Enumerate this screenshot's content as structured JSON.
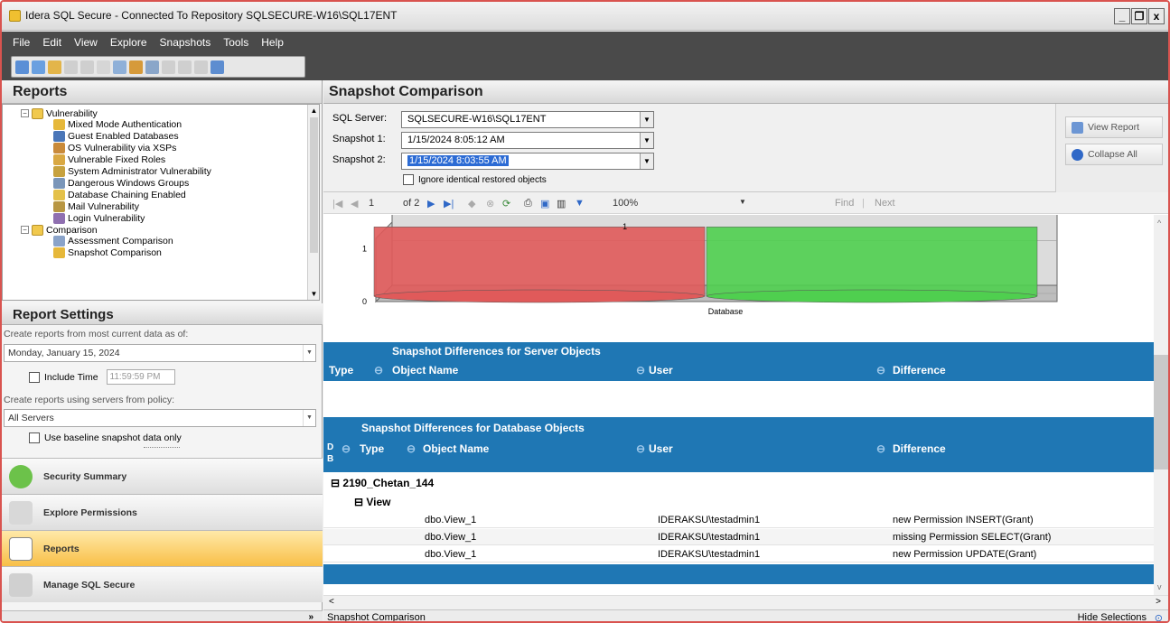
{
  "window": {
    "title": "Idera SQL Secure - Connected To Repository SQLSECURE-W16\\SQL17ENT",
    "controls": [
      "_",
      "❐",
      "x"
    ]
  },
  "menu": [
    "File",
    "Edit",
    "View",
    "Explore",
    "Snapshots",
    "Tools",
    "Help"
  ],
  "reports_pane": {
    "title": "Reports",
    "tree": [
      {
        "label": "Vulnerability",
        "level": 1,
        "type": "folder",
        "expand": "−"
      },
      {
        "label": "Mixed Mode Authentication",
        "level": 2
      },
      {
        "label": "Guest Enabled Databases",
        "level": 2
      },
      {
        "label": "OS Vulnerability via XSPs",
        "level": 2
      },
      {
        "label": "Vulnerable Fixed Roles",
        "level": 2
      },
      {
        "label": "System Administrator Vulnerability",
        "level": 2
      },
      {
        "label": "Dangerous Windows Groups",
        "level": 2
      },
      {
        "label": "Database Chaining Enabled",
        "level": 2
      },
      {
        "label": "Mail Vulnerability",
        "level": 2
      },
      {
        "label": "Login Vulnerability",
        "level": 2
      },
      {
        "label": "Comparison",
        "level": 1,
        "type": "folder",
        "expand": "−"
      },
      {
        "label": "Assessment Comparison",
        "level": 2
      },
      {
        "label": "Snapshot Comparison",
        "level": 2
      }
    ]
  },
  "report_settings": {
    "title": "Report Settings",
    "date_label": "Create reports from most current data as of:",
    "date_value": "Monday, January 15, 2024",
    "include_time_label": "Include Time",
    "time_value": "11:59:59 PM",
    "policy_label": "Create reports using servers from policy:",
    "policy_value": "All Servers",
    "baseline_label": "Use baseline snapshot data only"
  },
  "nav": [
    {
      "label": "Security Summary",
      "active": false
    },
    {
      "label": "Explore Permissions",
      "active": false
    },
    {
      "label": "Reports",
      "active": true
    },
    {
      "label": "Manage SQL Secure",
      "active": false
    }
  ],
  "snapshot_comparison": {
    "title": "Snapshot Comparison",
    "sql_server_label": "SQL Server:",
    "sql_server_value": "SQLSECURE-W16\\SQL17ENT",
    "snapshot1_label": "Snapshot 1:",
    "snapshot1_value": "1/15/2024 8:05:12 AM",
    "snapshot2_label": "Snapshot 2:",
    "snapshot2_value": "1/15/2024 8:03:55 AM",
    "ignore_label": "Ignore identical restored objects",
    "view_report_label": "View Report",
    "collapse_all_label": "Collapse All"
  },
  "report_toolbar": {
    "page": "1",
    "of": "of 2",
    "zoom": "100%",
    "find": "Find",
    "next": "Next"
  },
  "chart_data": {
    "type": "bar",
    "categories": [
      "Database"
    ],
    "series": [
      {
        "values": [
          1
        ],
        "color": "#e05a5a"
      },
      {
        "values": [
          1
        ],
        "color": "#4fcf4f"
      }
    ],
    "yticks": [
      "0",
      "1"
    ],
    "data_labels": [
      "1"
    ],
    "xlabel": "Database"
  },
  "server_objects": {
    "title": "Snapshot Differences for Server Objects",
    "columns": [
      "Type",
      "Object Name",
      "User",
      "Difference"
    ]
  },
  "database_objects": {
    "title": "Snapshot Differences for Database Objects",
    "col_d": "D",
    "col_b": "B",
    "columns": [
      "Type",
      "Object Name",
      "User",
      "Difference"
    ],
    "group": "2190_Chetan_144",
    "subgroup": "View",
    "rows": [
      {
        "object": "dbo.View_1",
        "user": "IDERAKSU\\testadmin1",
        "difference": "new Permission INSERT(Grant)"
      },
      {
        "object": "dbo.View_1",
        "user": "IDERAKSU\\testadmin1",
        "difference": "missing Permission SELECT(Grant)"
      },
      {
        "object": "dbo.View_1",
        "user": "IDERAKSU\\testadmin1",
        "difference": "new Permission UPDATE(Grant)"
      }
    ]
  },
  "status": {
    "left": "Snapshot Comparison",
    "right": "Hide Selections"
  },
  "colors": {
    "band": "#1f77b4",
    "active_nav": "#f8bf47",
    "menu_bg": "#4a4a4a"
  }
}
